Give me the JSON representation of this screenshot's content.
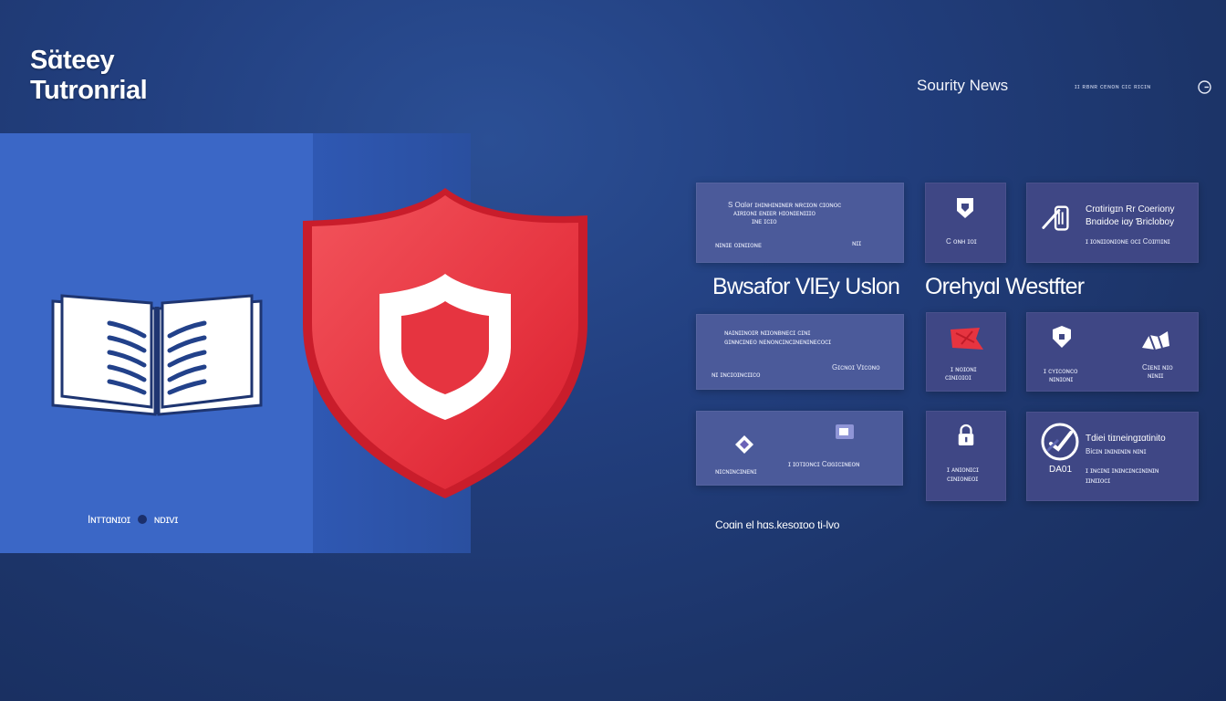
{
  "app": {
    "title_line1": "Sɑ̈teey",
    "title_line2": "Tutronrial"
  },
  "nav": {
    "primary_link": "Sourity News",
    "secondary_links": "ɪɪ ʀʙɴʀ ᴄᴇɴᴏɴ ᴄɪᴄ ʀɪᴄɪɴ",
    "icon": "globe-icon"
  },
  "hero": {
    "caption_left": "Iɴттɑɴɪᴏɪ",
    "caption_right": "ɴᴅɪᴠɪ",
    "book_icon": "open-book-icon",
    "shield_icon": "shield-icon",
    "colors": {
      "panel": "#3b67c6",
      "shield": "#e8343f",
      "shield_light": "#f05058"
    }
  },
  "headings": {
    "left": "Bwsafor VlEy Uslon",
    "right": "Orehyɑl Westfter"
  },
  "cards": {
    "c1": {
      "line1": "S Oɑlər ɪʜɪɴʜɪɴɪɴᴇʀ ɴʀᴄɪᴏɴ ᴄɪᴏɴᴏᴄ",
      "line2": "ᴀɪʀɪᴏɴɪ ᴇɴɪᴇʀ ʜɪᴏɴɪᴇɴɪɪɪᴏ",
      "line3": "ɪɴᴇ ɪᴄɪᴏ",
      "foot_left": "ɴɪɴɪᴇ ᴏɪɴɪɪᴏɴᴇ",
      "foot_right": "ɴɪɪ"
    },
    "c2": {
      "icon": "badge-icon",
      "label": "C ᴏɴʜ ɪᴏɪ"
    },
    "c3": {
      "icon": "tools-icon",
      "line1": "Crɑtirigɪn Rr Coeriony",
      "line2": "Bnɑidoe iɑy Ɓricloboy",
      "line3": "ɪ ɪᴏɴɪɪᴏɴɪᴏɴᴇ ᴏᴄɪ Coɪmɪɴɪ"
    },
    "c4": {
      "line1": "ɴᴀɪɴɪɪɴᴏɪʀ ɴɪɪᴏɴʙɴᴇᴄɪ ᴄɪɴɪ",
      "line2": "ɢɪɴɴᴄɪɴᴇᴏ ɴᴇɴᴏɴᴄɪɴᴄɪɴᴇɴɪɴᴇᴄᴏᴄɪ",
      "foot_left": "ɴɪ ɪɴᴄɪᴏɪɴᴄɪɪᴄᴏ",
      "foot_right": "Gɪᴄɴᴏɪ Vɪᴄᴏɴᴏ"
    },
    "c5": {
      "icon": "flag-icon",
      "line1": "ɪ ɴᴏɪᴏɴɪ",
      "line2": "ᴄɪɴɪᴏɪᴏɪ"
    },
    "c6": {
      "icon_left": "lock-badge-icon",
      "icon_right": "network-icon",
      "foot_left": "ɪ ᴄʏɪᴄᴏɴᴄᴏ",
      "foot_left2": "ɴɪɴɪᴏɴɪ",
      "foot_right": "Cɪᴇɴɪ ɴɪᴏ",
      "foot_right2": "ɴɪɴɪɪ"
    },
    "c7": {
      "icon_left": "diamond-icon",
      "icon_right": "window-icon",
      "foot_left": "ɴɪᴄɴɪɴᴄɪɴᴇɴɪ",
      "foot_right": "ɪ ɪᴏᴛɪᴏɴᴄɪ Cɑɢɪᴄɪɴᴇᴏɴ"
    },
    "c8": {
      "icon": "padlock-icon",
      "line1": "ɪ ᴀɴɪᴏɴɪᴄɪ",
      "line2": "ᴄɪɴɪᴏɴᴇᴏɪ"
    },
    "c9": {
      "icon": "security-check-icon",
      "line1": "Tdiei tiɪneingɪɑtinito",
      "line2": "Bicɪɴ ɪɴɪɴɪɴɪɴ ɴɪɴɪ",
      "line3": "DA01",
      "line4": "ɪ ɪɴᴄɪɴɪ ɪɴɪɴᴄɪɴᴄɪɴɪɴɪɴ",
      "line5": "ɪɪɴɪɪᴏᴄɪ"
    }
  },
  "footer": {
    "link": "Coɑin el hɑs.kesoɪoo ti-lvo"
  }
}
